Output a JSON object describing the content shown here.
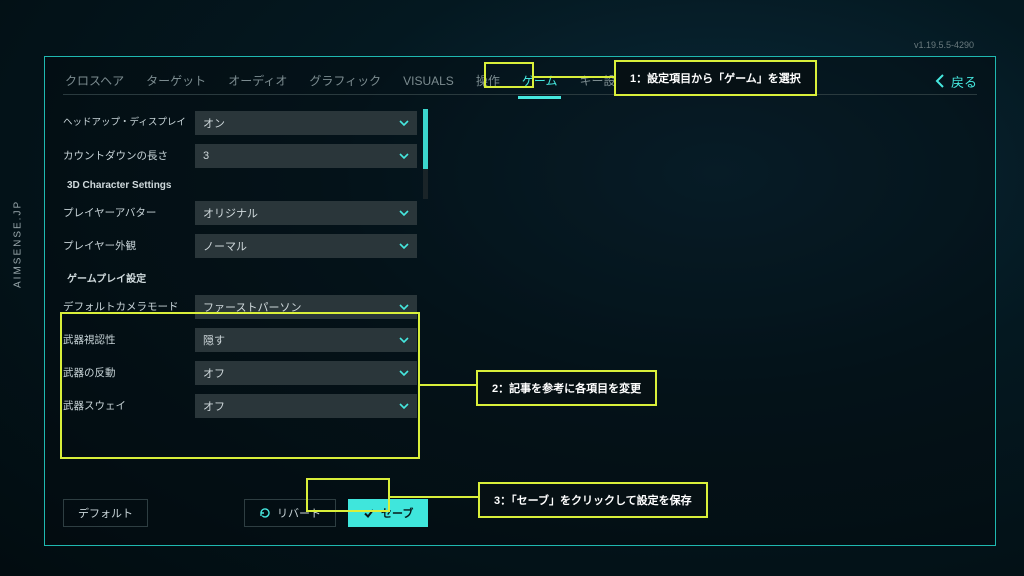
{
  "watermark": "AIMSENSE.JP",
  "version": "v1.19.5.5-4290",
  "back_label": "戻る",
  "tabs": [
    {
      "label": "クロスヘア"
    },
    {
      "label": "ターゲット"
    },
    {
      "label": "オーディオ"
    },
    {
      "label": "グラフィック"
    },
    {
      "label": "VISUALS"
    },
    {
      "label": "操作"
    },
    {
      "label": "ゲーム",
      "active": true
    },
    {
      "label": "キー設定"
    }
  ],
  "rows_top": [
    {
      "label": "ヘッドアップ・ディスプレイ",
      "value": "オン",
      "small": true
    },
    {
      "label": "カウントダウンの長さ",
      "value": "3"
    }
  ],
  "section_3d": "3D Character Settings",
  "rows_3d": [
    {
      "label": "プレイヤーアバター",
      "value": "オリジナル"
    },
    {
      "label": "プレイヤー外観",
      "value": "ノーマル"
    }
  ],
  "section_gp": "ゲームプレイ設定",
  "rows_gp": [
    {
      "label": "デフォルトカメラモード",
      "value": "ファーストパーソン"
    },
    {
      "label": "武器視認性",
      "value": "隠す"
    },
    {
      "label": "武器の反動",
      "value": "オフ"
    },
    {
      "label": "武器スウェイ",
      "value": "オフ"
    }
  ],
  "buttons": {
    "default": "デフォルト",
    "revert": "リバート",
    "save": "セーブ"
  },
  "callouts": {
    "c1": "1：設定項目から「ゲーム」を選択",
    "c2": "2：記事を参考に各項目を変更",
    "c3": "3：「セーブ」をクリックして設定を保存"
  }
}
